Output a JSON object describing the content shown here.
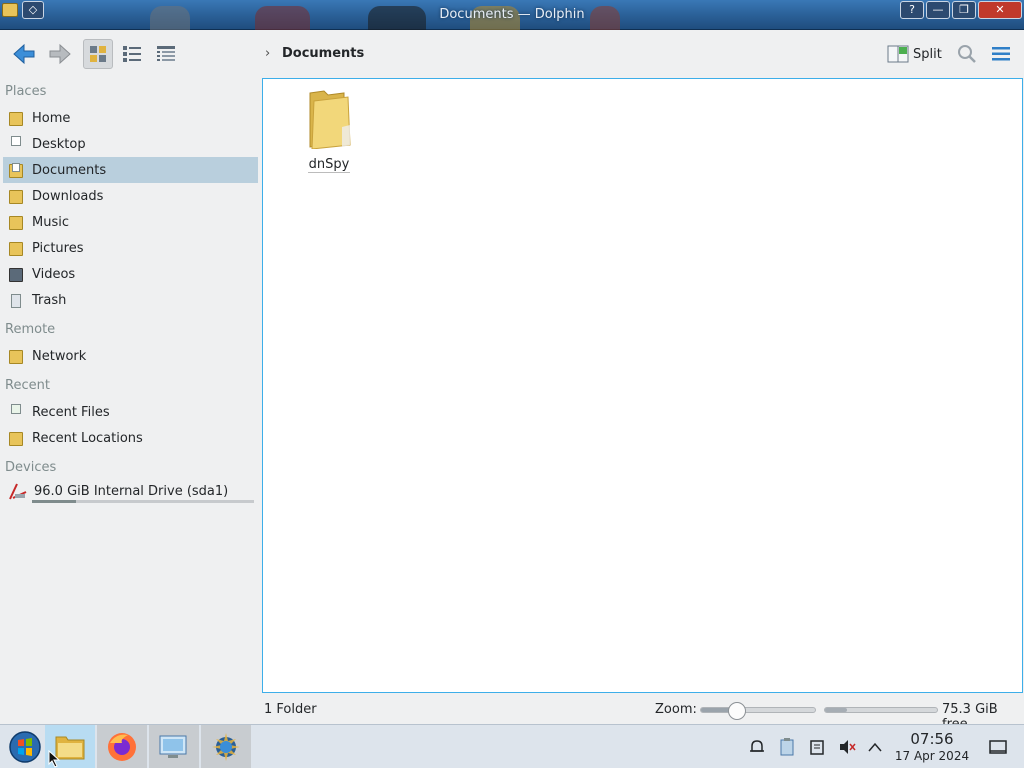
{
  "window": {
    "title": "Documents — Dolphin"
  },
  "breadcrumb": {
    "current": "Documents"
  },
  "toolbar": {
    "split_label": "Split"
  },
  "sidebar": {
    "sections": {
      "places": "Places",
      "remote": "Remote",
      "recent": "Recent",
      "devices": "Devices"
    },
    "places": [
      {
        "label": "Home",
        "icon": "home-folder-icon"
      },
      {
        "label": "Desktop",
        "icon": "desktop-icon"
      },
      {
        "label": "Documents",
        "icon": "documents-folder-icon",
        "selected": true
      },
      {
        "label": "Downloads",
        "icon": "downloads-folder-icon"
      },
      {
        "label": "Music",
        "icon": "music-folder-icon"
      },
      {
        "label": "Pictures",
        "icon": "pictures-folder-icon"
      },
      {
        "label": "Videos",
        "icon": "videos-folder-icon"
      },
      {
        "label": "Trash",
        "icon": "trash-icon"
      }
    ],
    "remote": [
      {
        "label": "Network",
        "icon": "network-folder-icon"
      }
    ],
    "recent": [
      {
        "label": "Recent Files",
        "icon": "recent-files-icon"
      },
      {
        "label": "Recent Locations",
        "icon": "recent-locations-icon"
      }
    ],
    "devices": [
      {
        "label": "96.0 GiB Internal Drive (sda1)",
        "icon": "drive-icon",
        "usage_fraction": 0.2
      }
    ]
  },
  "files": [
    {
      "name": "dnSpy",
      "type": "folder"
    }
  ],
  "status": {
    "summary": "1 Folder",
    "zoom_label": "Zoom:",
    "zoom_fraction": 0.28,
    "free_label": "75.3 GiB free",
    "used_fraction": 0.2
  },
  "taskbar": {
    "apps": [
      "start-menu",
      "dolphin-file-manager",
      "firefox",
      "system-settings",
      "kde-app"
    ],
    "clock_time": "07:56",
    "clock_date": "17 Apr 2024"
  },
  "colors": {
    "accent": "#3daee9",
    "selection": "#b9cfdd",
    "titlebar": "#2a5f96"
  }
}
